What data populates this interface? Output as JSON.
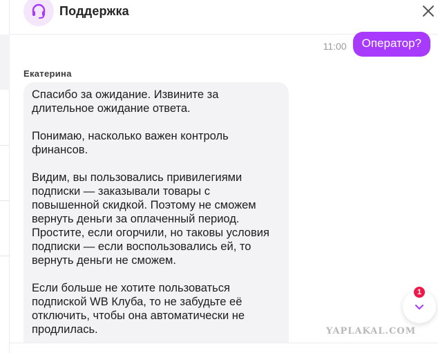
{
  "header": {
    "title": "Поддержка"
  },
  "conversation": {
    "outgoing": {
      "time": "11:00",
      "text": "Оператор?"
    },
    "incoming": {
      "sender": "Екатерина",
      "paragraphs": [
        "Спасибо за ожидание. Извините за длительное ожидание ответа.",
        "Понимаю, насколько важен контроль финансов.",
        "Видим, вы пользовались привилегиями подписки — заказывали товары с повышенной скидкой. Поэтому не сможем вернуть деньги за оплаченный период. Простите, если огорчили, но таковы условия подписки — если воспользовались ей, то вернуть деньги не сможем.",
        "Если больше не хотите пользоваться подпиской WB Клуба, то не забудьте её отключить, чтобы она автоматически не продлилась."
      ]
    }
  },
  "scroll_button": {
    "badge_count": "1"
  },
  "watermark": "YAPLAKAL.COM",
  "colors": {
    "accent": "#a73afd",
    "badge": "#f0184a",
    "bubble_bg": "#f3f3f6",
    "avatar_bg": "#f4e6fb"
  },
  "icons": {
    "avatar": "headset-icon",
    "close": "close-icon",
    "scroll": "chevron-down-icon"
  }
}
